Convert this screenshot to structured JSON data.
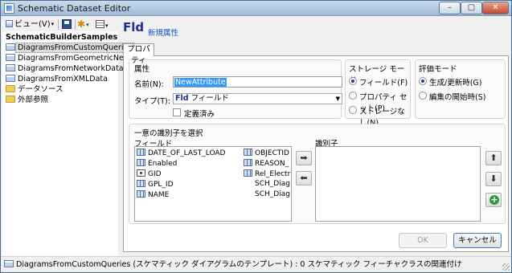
{
  "window": {
    "title": "Schematic Dataset Editor",
    "minimize": "–",
    "maximize": "▢",
    "close": "✕"
  },
  "toolbar": {
    "view_label": "ビュー(V)",
    "caret": "▾",
    "sun_glyph": "✱"
  },
  "tree": {
    "root": "SchematicBuilderSamples",
    "items": [
      {
        "label": "DiagramsFromCustomQueries",
        "icon": "dataset-icon",
        "selected": true
      },
      {
        "label": "DiagramsFromGeometricNetwork",
        "icon": "dataset-icon",
        "selected": false
      },
      {
        "label": "DiagramsFromNetworkDataset",
        "icon": "dataset-icon",
        "selected": false
      },
      {
        "label": "DiagramsFromXMLData",
        "icon": "dataset-icon",
        "selected": false
      },
      {
        "label": "データソース",
        "icon": "folder-icon",
        "selected": false
      },
      {
        "label": "外部参照",
        "icon": "folder-icon",
        "selected": false
      }
    ]
  },
  "main": {
    "heading": "Fld",
    "subheading": "新規属性",
    "tab_label": "プロパティ",
    "attribute_group": {
      "title": "属性",
      "name_label": "名前(N):",
      "name_value": "NewAttribute",
      "type_label": "タイプ(T):",
      "type_prefix": "Fld",
      "type_value": "フィールド",
      "type_arrow": "▼",
      "defined_label": "定義済み",
      "defined_checked": false
    },
    "storage_group": {
      "title": "ストレージ モード",
      "options": [
        "フィールド(F)",
        "プロパティ セット(P)",
        "ストレージなし(N)"
      ],
      "selected_index": 0
    },
    "eval_group": {
      "title": "評価モード",
      "options": [
        "生成/更新時(G)",
        "編集の開始時(S)"
      ],
      "selected_index": 0
    },
    "identifier_group": {
      "title": "一意の識別子を選択",
      "fields_label": "フィールド",
      "identifiers_label": "識別子",
      "fields_left": [
        {
          "name": "DATE_OF_LAST_LOAD",
          "icon": "table-field-icon"
        },
        {
          "name": "Enabled",
          "icon": "table-field-icon"
        },
        {
          "name": "GID",
          "icon": "gid-icon"
        },
        {
          "name": "GPL_ID",
          "icon": "table-field-icon"
        },
        {
          "name": "NAME",
          "icon": "table-field-icon"
        }
      ],
      "fields_right": [
        {
          "name": "OBJECTID",
          "icon": "table-field-icon"
        },
        {
          "name": "REASON_",
          "icon": "table-field-icon"
        },
        {
          "name": "Rel_Electri",
          "icon": "table-field-icon"
        },
        {
          "name": "SCH_Diag",
          "icon": "none"
        },
        {
          "name": "SCH_Diag",
          "icon": "none"
        }
      ],
      "add_arrow": "➡",
      "remove_arrow": "⬅",
      "up_arrow": "⬆",
      "down_arrow": "⬇",
      "add_glyph": "+"
    },
    "ok_label": "OK",
    "cancel_label": "キャンセル"
  },
  "status": {
    "text": "DiagramsFromCustomQueries (スケマティック ダイアグラムのテンプレート) : 0 スケマティック フィーチャクラスの関連付け"
  }
}
